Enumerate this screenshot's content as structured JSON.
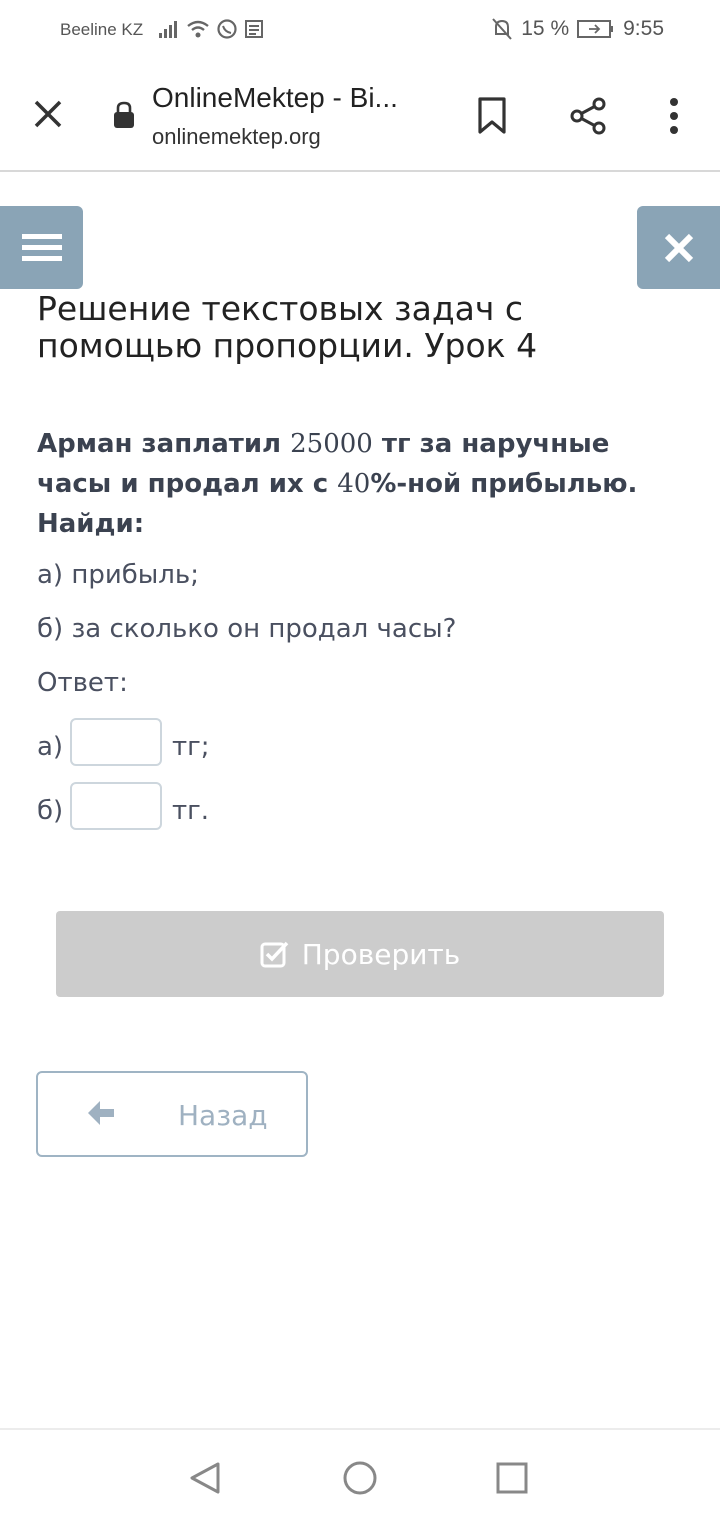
{
  "status_bar": {
    "carrier": "Beeline KZ",
    "battery": "15 %",
    "time": "9:55"
  },
  "browser": {
    "title": "OnlineMektep - Bi...",
    "url": "onlinemektep.org"
  },
  "lesson": {
    "title": "Решение текстовых задач с помощью пропорции. Урок 4"
  },
  "task": {
    "part1": "Арман заплатил ",
    "num1": "25000",
    "part2": " тг за наручные часы и продал их с ",
    "num2": "40",
    "part3": "%-ной прибылью. Найди:",
    "item_a": "а) прибыль;",
    "item_b": "б) за сколько он продал часы?",
    "answer_label": "Ответ:",
    "answer_a_prefix": "а)",
    "answer_a_unit": "тг;",
    "answer_b_prefix": "б)",
    "answer_b_unit": "тг."
  },
  "buttons": {
    "check": "Проверить",
    "back": "Назад"
  },
  "colors": {
    "accent": "#8aa4b6",
    "check_bg": "#cccccc",
    "back_border": "#9fb4c4"
  }
}
